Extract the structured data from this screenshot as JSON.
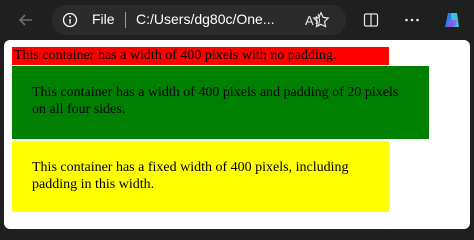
{
  "browser": {
    "address_label": "File",
    "url": "C:/Users/dg80c/One...",
    "icons": [
      "back-arrow-icon",
      "info-icon",
      "read-aloud-icon",
      "favorite-star-icon",
      "split-screen-icon",
      "more-icon",
      "copilot-icon"
    ]
  },
  "content": {
    "box1_text": "This container has a width of 400 pixels with no padding.",
    "box2_text": "This container has a width of 400 pixels and padding of 20 pixels on all four sides.",
    "box3_text": "This container has a fixed width of 400 pixels, including padding in this width."
  },
  "colors": {
    "box1": "#ff0000",
    "box2": "#008000",
    "box3": "#ffff00"
  }
}
